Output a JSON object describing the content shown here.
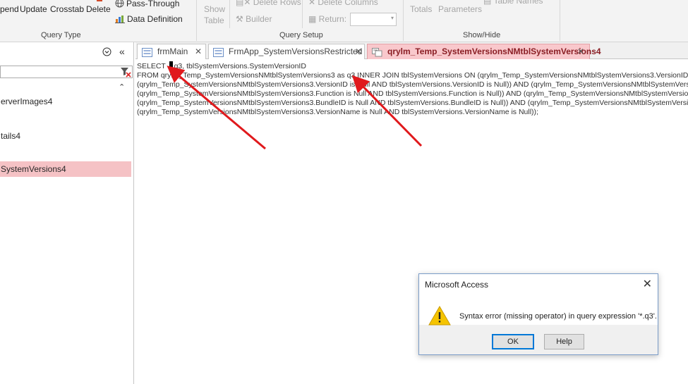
{
  "ribbon": {
    "query_type": {
      "append_label": "pend",
      "update_label": "Update",
      "crosstab_label": "Crosstab",
      "delete_label": "Delete",
      "pass_through_label": "Pass-Through",
      "data_definition_label": "Data Definition",
      "group_label": "Query Type"
    },
    "query_setup": {
      "show_label": "Show",
      "table_label": "Table",
      "delete_rows_label": "Delete Rows",
      "builder_label": "Builder",
      "delete_columns_label": "Delete Columns",
      "return_label": "Return:",
      "group_label": "Query Setup"
    },
    "show_hide": {
      "totals_label": "Totals",
      "parameters_label": "Parameters",
      "table_names_label": "Table Names",
      "group_label": "Show/Hide"
    }
  },
  "nav": {
    "items": [
      {
        "label": "erverImages4",
        "selected": false
      },
      {
        "label": "tails4",
        "selected": false
      },
      {
        "label": "SystemVersions4",
        "selected": true
      }
    ]
  },
  "tabs": [
    {
      "label": "frmMain",
      "active": false
    },
    {
      "label": "FrmApp_SystemVersionsRestricted",
      "active": false
    },
    {
      "label": "qrylm_Temp_SystemVersionsNMtblSystemVersions4",
      "active": true
    }
  ],
  "sql": {
    "line1_pre": "SELECT ",
    "line1_post": "q3, tblSystemVersions.SystemVersionID",
    "line2": "FROM qrylm_Temp_SystemVersionsNMtblSystemVersions3 as q3 INNER JOIN tblSystemVersions ON (qrylm_Temp_SystemVersionsNMtblSystemVersions3.VersionID = t",
    "line3": "(qrylm_Temp_SystemVersionsNMtblSystemVersions3.VersionID is Null AND  tblSystemVersions.VersionID is Null)) AND (qrylm_Temp_SystemVersionsNMtblSystemVersio",
    "line4": "(qrylm_Temp_SystemVersionsNMtblSystemVersions3.Function is Null AND tblSystemVersions.Function is Null)) AND (qrylm_Temp_SystemVersionsNMtblSystemVersions3",
    "line5": "(qrylm_Temp_SystemVersionsNMtblSystemVersions3.BundleID is Null AND tblSystemVersions.BundleID is Null)) AND (qrylm_Temp_SystemVersionsNMtblSystemVersions",
    "line6": "(qrylm_Temp_SystemVersionsNMtblSystemVersions3.VersionName is Null AND  tblSystemVersions.VersionName is Null));"
  },
  "dialog": {
    "title": "Microsoft Access",
    "close_glyph": "✕",
    "message": "Syntax error (missing operator) in query expression '*.q3'.",
    "ok_label": "OK",
    "help_label": "Help"
  },
  "colors": {
    "active_tab": "#f9c8cc",
    "nav_selected": "#f5c2c5",
    "annotation_arrow": "#e0191c",
    "ok_focus": "#0078d7"
  },
  "icons": {
    "pass_through": "globe-icon",
    "data_definition": "chart-icon",
    "tab_form": "form-icon",
    "tab_query": "query-icon",
    "warning": "warning-icon"
  }
}
